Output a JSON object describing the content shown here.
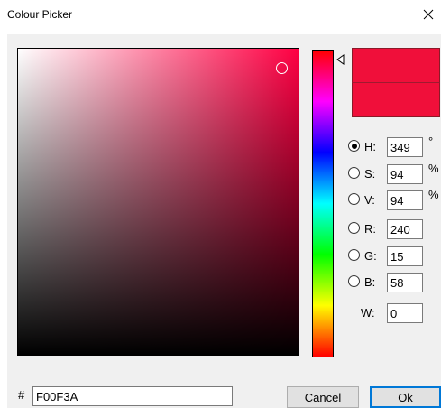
{
  "window": {
    "title": "Colour Picker",
    "close_glyph": "×"
  },
  "colors": {
    "selected": "#F00F3A",
    "hue_pure": "#ff0043"
  },
  "fields": {
    "h": {
      "label": "H:",
      "value": "349",
      "unit": "°",
      "selected": true
    },
    "s": {
      "label": "S:",
      "value": "94",
      "unit": "%"
    },
    "v": {
      "label": "V:",
      "value": "94",
      "unit": "%"
    },
    "r": {
      "label": "R:",
      "value": "240"
    },
    "g": {
      "label": "G:",
      "value": "15"
    },
    "b": {
      "label": "B:",
      "value": "58"
    },
    "w": {
      "label": "W:",
      "value": "0"
    }
  },
  "hex": {
    "label": "#",
    "value": "F00F3A"
  },
  "buttons": {
    "cancel": "Cancel",
    "ok": "Ok"
  },
  "icons": {
    "close": "close-icon",
    "hue_marker_left": "triangle-right-icon",
    "hue_marker_right": "triangle-left-icon"
  }
}
